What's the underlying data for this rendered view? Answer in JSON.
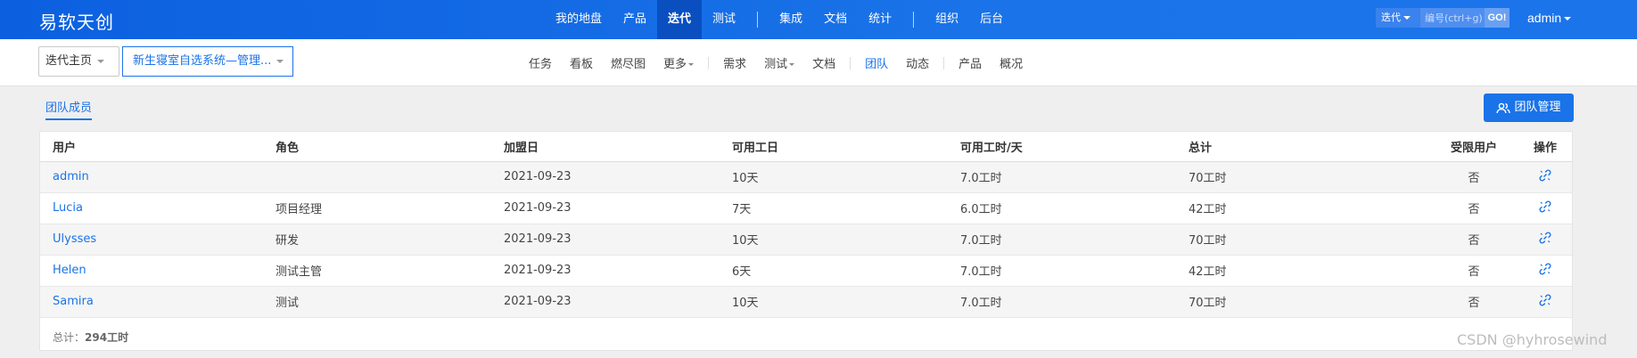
{
  "brand": "易软天创",
  "main_nav": [
    {
      "label": "我的地盘"
    },
    {
      "label": "产品"
    },
    {
      "label": "迭代",
      "active": true
    },
    {
      "label": "测试"
    },
    {
      "label": "集成"
    },
    {
      "label": "文档"
    },
    {
      "label": "统计"
    },
    {
      "label": "组织"
    },
    {
      "label": "后台"
    }
  ],
  "search": {
    "type": "迭代",
    "placeholder": "编号(ctrl+g)",
    "go": "GO!"
  },
  "user": "admin",
  "breadcrumb": {
    "home": "迭代主页",
    "project": "新生寝室自选系统—管理..."
  },
  "sub_nav": [
    {
      "label": "任务"
    },
    {
      "label": "看板"
    },
    {
      "label": "燃尽图"
    },
    {
      "label": "更多"
    },
    {
      "label": "需求"
    },
    {
      "label": "测试"
    },
    {
      "label": "文档"
    },
    {
      "label": "团队",
      "active": true
    },
    {
      "label": "动态"
    },
    {
      "label": "产品"
    },
    {
      "label": "概况"
    }
  ],
  "tab_label": "团队成员",
  "manage_button": "团队管理",
  "table": {
    "headers": {
      "user": "用户",
      "role": "角色",
      "join": "加盟日",
      "days": "可用工日",
      "hours": "可用工时/天",
      "total": "总计",
      "limited": "受限用户",
      "op": "操作"
    },
    "rows": [
      {
        "user": "admin",
        "role": "",
        "join": "2021-09-23",
        "days": "10天",
        "hours": "7.0工时",
        "total": "70工时",
        "limited": "否"
      },
      {
        "user": "Lucia",
        "role": "项目经理",
        "join": "2021-09-23",
        "days": "7天",
        "hours": "6.0工时",
        "total": "42工时",
        "limited": "否"
      },
      {
        "user": "Ulysses",
        "role": "研发",
        "join": "2021-09-23",
        "days": "10天",
        "hours": "7.0工时",
        "total": "70工时",
        "limited": "否"
      },
      {
        "user": "Helen",
        "role": "测试主管",
        "join": "2021-09-23",
        "days": "6天",
        "hours": "7.0工时",
        "total": "42工时",
        "limited": "否"
      },
      {
        "user": "Samira",
        "role": "测试",
        "join": "2021-09-23",
        "days": "10天",
        "hours": "7.0工时",
        "total": "70工时",
        "limited": "否"
      }
    ]
  },
  "footer": {
    "label": "总计：",
    "value": "294工时"
  },
  "watermark": "CSDN @hyhrosewind",
  "colors": {
    "primary": "#1a73e8",
    "topbar": "#0c60e0"
  }
}
